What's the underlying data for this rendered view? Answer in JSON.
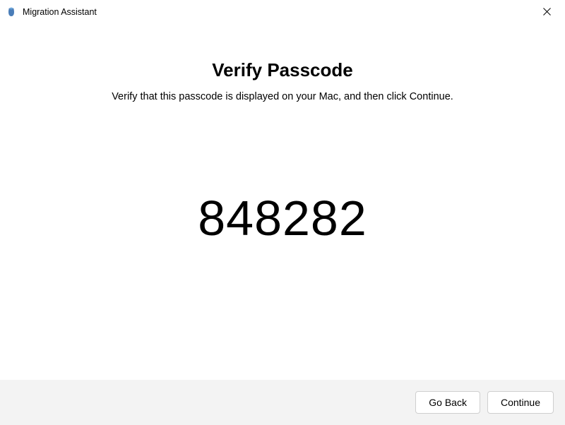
{
  "titlebar": {
    "app_name": "Migration Assistant"
  },
  "main": {
    "heading": "Verify Passcode",
    "instruction": "Verify that this passcode is displayed on your Mac, and then click Continue.",
    "passcode": "848282"
  },
  "footer": {
    "go_back_label": "Go Back",
    "continue_label": "Continue"
  }
}
